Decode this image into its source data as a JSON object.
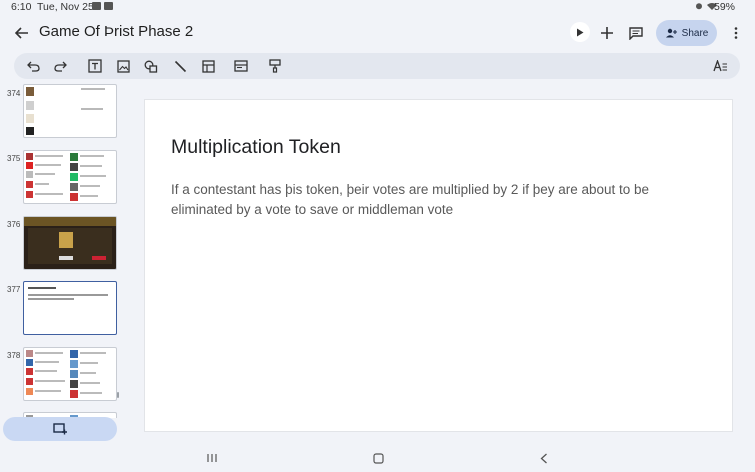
{
  "status_bar": {
    "time": "6:10",
    "date": "Tue, Nov 25",
    "battery": "59%"
  },
  "header": {
    "title": "Game Of Þrist Phase 2",
    "share_label": "Share"
  },
  "filmstrip": {
    "slides": [
      {
        "number": "374"
      },
      {
        "number": "375"
      },
      {
        "number": "376"
      },
      {
        "number": "377"
      },
      {
        "number": "378"
      }
    ]
  },
  "slide": {
    "title": "Multiplication Token",
    "body": "If a contestant has þis token, þeir votes are multiplied by 2 if þey are about to be eliminated by a vote to save or middleman vote"
  },
  "colors": {
    "accent": "#c6d4ee",
    "selected_border": "#3f5fa0",
    "background": "#f1f3f8"
  }
}
